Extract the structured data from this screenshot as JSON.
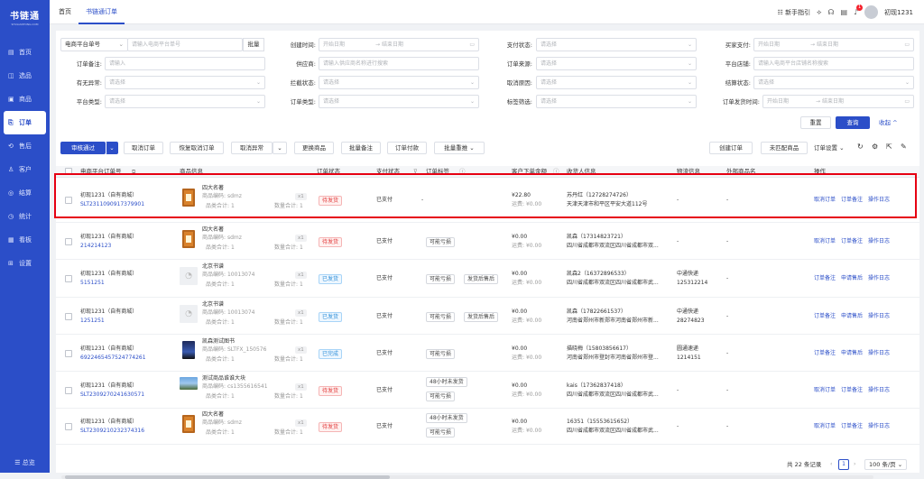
{
  "app": {
    "name": "书链通",
    "subtitle": "SHULIANTONG.COM"
  },
  "nav": [
    {
      "icon": "▤",
      "label": "首页"
    },
    {
      "icon": "◫",
      "label": "选品"
    },
    {
      "icon": "▣",
      "label": "商品"
    },
    {
      "icon": "⎘",
      "label": "订单"
    },
    {
      "icon": "⟲",
      "label": "售后"
    },
    {
      "icon": "♙",
      "label": "客户"
    },
    {
      "icon": "◎",
      "label": "结算"
    },
    {
      "icon": "◷",
      "label": "统计"
    },
    {
      "icon": "▦",
      "label": "看板"
    },
    {
      "icon": "⊞",
      "label": "设置"
    }
  ],
  "nav_footer": "☰ 总览",
  "tabs": [
    "首页",
    "书链通订单"
  ],
  "topbar": {
    "guide": "新手指引",
    "notice_count": "1",
    "user": "初现1231"
  },
  "filters": {
    "platform_order_select": "电商平台单号",
    "platform_order_ph": "请输入电商平台单号",
    "batch": "批量",
    "create_time": "创建时间:",
    "start_date": "开始日期",
    "end_date": "结束日期",
    "arrow": "→",
    "pay_status": "支付状态:",
    "buyer_pay": "买家支付:",
    "order_remark": "订单备注:",
    "input_ph": "请输入",
    "supplier": "供应商:",
    "supplier_ph": "请输入供应商名称进行搜索",
    "order_source": "订单来源:",
    "platform_shop": "平台店铺:",
    "shop_ph": "请输入电商平台店铺名称搜索",
    "abnormal": "有无异常:",
    "intercept": "拦截状态:",
    "cancel_reason": "取消原因:",
    "settle": "结算状态:",
    "platform_type": "平台类型:",
    "order_type": "订单类型:",
    "tag_filter": "标签筛选:",
    "ship_time": "订单发货时间:",
    "select_ph": "请选择",
    "reset": "重置",
    "query": "查询",
    "collapse": "收起 ^"
  },
  "toolbar": {
    "approve": "审核通过",
    "cancel_order": "取消订单",
    "restore_cancel": "恢复取消订单",
    "cancel_abnormal": "取消异常",
    "change_product": "更换商品",
    "batch_remark": "批量备注",
    "order_pay": "订单付款",
    "batch_push": "批量重推 ⌄",
    "create_order": "创建订单",
    "unmatched": "未匹配商品",
    "order_settings": "订单设置 ⌄"
  },
  "columns": [
    "电商平台订单号",
    "商品信息",
    "订单状态",
    "支付状态",
    "订单标签",
    "客户下单金额",
    "收货人信息",
    "物流信息",
    "外部商品名",
    "操作"
  ],
  "labels": {
    "product_code": "商品编码:",
    "sku_total": "品类合计:",
    "qty_total": "数量合计:",
    "freight": "运费:"
  },
  "orders": [
    {
      "shop": "初现1231（自有商城）",
      "order_no": "SLT2311090917379901",
      "thumb": "book",
      "title": "四大名著",
      "code": "sdmz",
      "qty": "x1",
      "sku": "1",
      "num": "1",
      "status": "待发货",
      "status_type": "red",
      "pay": "已支付",
      "tags": [
        "-"
      ],
      "amount": "¥22.80",
      "freight": "¥0.00",
      "receiver": "苏丹红（12728274726）",
      "address": "天津天津市和平区平安大道112号",
      "logistics": [
        "-"
      ],
      "ext": "-",
      "ops": [
        "取消订单",
        "订单备注",
        "操作日志"
      ]
    },
    {
      "shop": "初现1231（自有商城）",
      "order_no": "214214123",
      "thumb": "book",
      "title": "四大名著",
      "code": "sdmz",
      "qty": "x1",
      "sku": "1",
      "num": "1",
      "status": "待发货",
      "status_type": "red",
      "pay": "已支付",
      "tags": [
        "可能亏损"
      ],
      "amount": "¥0.00",
      "freight": "¥0.00",
      "receiver": "凯森（17314823721）",
      "address": "四川省成都市双流区四川省成都市双...",
      "logistics": [
        "-"
      ],
      "ext": "-",
      "ops": [
        "取消订单",
        "订单备注",
        "操作日志"
      ]
    },
    {
      "shop": "初现1231（自有商城）",
      "order_no": "5151251",
      "thumb": "gray",
      "title": "北京书谱",
      "code": "10013074",
      "qty": "x1",
      "sku": "1",
      "num": "1",
      "status": "已发货",
      "status_type": "green",
      "pay": "已支付",
      "tags": [
        "可能亏损",
        "发货后售后"
      ],
      "amount": "¥0.00",
      "freight": "¥0.00",
      "receiver": "凯森2（16372896533）",
      "address": "四川省成都市双流区四川省成都市武...",
      "logistics": [
        "中通快递",
        "125312214"
      ],
      "ext": "-",
      "ops": [
        "订单备注",
        "申请售后",
        "操作日志"
      ]
    },
    {
      "shop": "初现1231（自有商城）",
      "order_no": "1251251",
      "thumb": "gray",
      "title": "北京书谱",
      "code": "10013074",
      "qty": "x1",
      "sku": "1",
      "num": "1",
      "status": "已发货",
      "status_type": "green",
      "pay": "已支付",
      "tags": [
        "可能亏损",
        "发货后售后"
      ],
      "amount": "¥0.00",
      "freight": "¥0.00",
      "receiver": "凯森（17822661537）",
      "address": "河南省郑州市新郑市河南省郑州市新...",
      "logistics": [
        "中通快递",
        "28274823"
      ],
      "ext": "-",
      "ops": [
        "订单备注",
        "申请售后",
        "操作日志"
      ]
    },
    {
      "shop": "初现1231（自有商城）",
      "order_no": "6922465457524774261",
      "thumb": "dark",
      "title": "凯森测试图书",
      "code": "SLTFX_150576",
      "qty": "x1",
      "sku": "1",
      "num": "1",
      "status": "已完成",
      "status_type": "green",
      "pay": "已支付",
      "tags": [
        "可能亏损"
      ],
      "amount": "¥0.00",
      "freight": "¥0.00",
      "receiver": "描晓梅（15803856617）",
      "address": "河南省郑州市登封市河南省郑州市登...",
      "logistics": [
        "圆通速递",
        "1214151"
      ],
      "ext": "-",
      "ops": [
        "订单备注",
        "申请售后",
        "操作日志"
      ]
    },
    {
      "shop": "初现1231（自有商城）",
      "order_no": "SLT2309270241630571",
      "thumb": "scene",
      "title": "测试商品谁谁大块",
      "code": "cs1355616541",
      "qty": "x1",
      "sku": "1",
      "num": "1",
      "status": "待发货",
      "status_type": "red",
      "pay": "已支付",
      "tags": [
        "48小时未发货",
        "可能亏损"
      ],
      "amount": "¥0.00",
      "freight": "¥0.00",
      "receiver": "kais（17362837418）",
      "address": "四川省成都市双流区四川省成都市武...",
      "logistics": [
        "-"
      ],
      "ext": "-",
      "ops": [
        "取消订单",
        "订单备注",
        "操作日志"
      ]
    },
    {
      "shop": "初现1231（自有商城）",
      "order_no": "SLT2309210232374316",
      "thumb": "book",
      "title": "四大名著",
      "code": "sdmz",
      "qty": "x1",
      "sku": "1",
      "num": "1",
      "status": "待发货",
      "status_type": "red",
      "pay": "已支付",
      "tags": [
        "48小时未发货",
        "可能亏损"
      ],
      "amount": "¥0.00",
      "freight": "¥0.00",
      "receiver": "16351（15553615652）",
      "address": "四川省成都市双流区四川省成都市武...",
      "logistics": [
        "-"
      ],
      "ext": "-",
      "ops": [
        "取消订单",
        "订单备注",
        "操作日志"
      ]
    }
  ],
  "pagination": {
    "total": "共 22 条记录",
    "page": "1",
    "size": "100 条/页 ⌄"
  },
  "colors": {
    "primary": "#2b4ec8",
    "highlight": "#e60012"
  }
}
